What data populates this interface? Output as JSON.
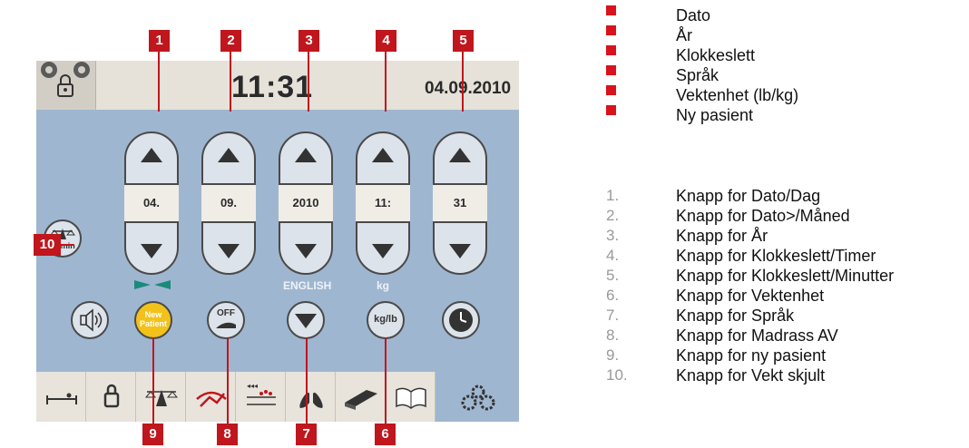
{
  "header": {
    "time": "11:31",
    "date": "04.09.2010"
  },
  "spinners": [
    {
      "value": "04."
    },
    {
      "value": "09."
    },
    {
      "value": "2010"
    },
    {
      "value": "11:"
    },
    {
      "value": "31"
    }
  ],
  "labels": {
    "language": "ENGLISH",
    "unit": "kg"
  },
  "buttons": {
    "new_patient_line1": "New",
    "new_patient_line2": "Patient",
    "off": "OFF",
    "kg_lb": "kg/lb",
    "one_min": "1 min"
  },
  "callouts": [
    "1",
    "2",
    "3",
    "4",
    "5",
    "6",
    "7",
    "8",
    "9",
    "10"
  ],
  "legend": {
    "color": "#d8131d",
    "items": [
      "Dato",
      "År",
      "Klokkeslett",
      "Språk",
      "Vektenhet (lb/kg)",
      "Ny pasient"
    ]
  },
  "numbered": [
    {
      "n": "1.",
      "text": "Knapp for Dato/Dag"
    },
    {
      "n": "2.",
      "text": "Knapp for Dato>/Måned"
    },
    {
      "n": "3.",
      "text": "Knapp for År"
    },
    {
      "n": "4.",
      "text": "Knapp for Klokkeslett/Timer"
    },
    {
      "n": "5.",
      "text": "Knapp for Klokkeslett/Minutter"
    },
    {
      "n": "6.",
      "text": "Knapp for Vektenhet"
    },
    {
      "n": "7.",
      "text": "Knapp for Språk"
    },
    {
      "n": "8.",
      "text": "Knapp for Madrass AV"
    },
    {
      "n": "9.",
      "text": "Knapp for ny pasient"
    },
    {
      "n": "10.",
      "text": "Knapp for Vekt skjult"
    }
  ]
}
